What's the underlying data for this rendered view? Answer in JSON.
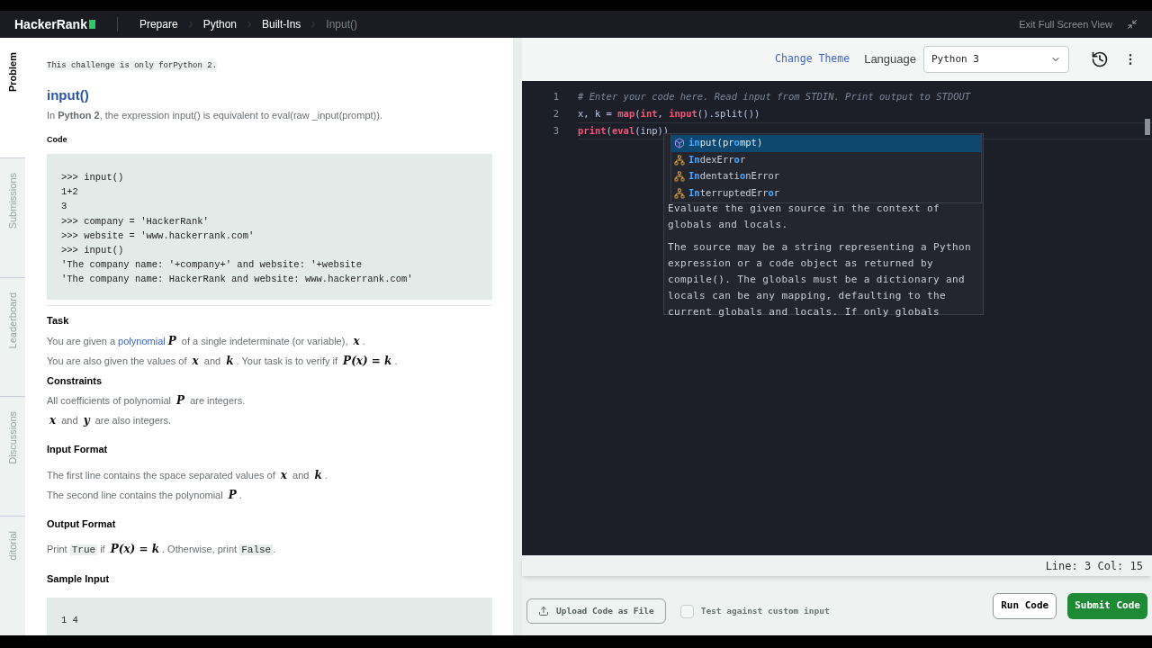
{
  "nav": {
    "logo": "HackerRank",
    "breadcrumbs": [
      {
        "label": "Prepare",
        "current": false
      },
      {
        "label": "Python",
        "current": false
      },
      {
        "label": "Built-Ins",
        "current": false
      },
      {
        "label": "Input()",
        "current": true
      }
    ],
    "exit": "Exit Full Screen View"
  },
  "side_tabs": [
    {
      "label": "Problem",
      "selected": true
    },
    {
      "label": "Submissions",
      "selected": false
    },
    {
      "label": "Leaderboard",
      "selected": false
    },
    {
      "label": "Discussions",
      "selected": false
    },
    {
      "label": "ditorial",
      "selected": false
    }
  ],
  "problem": {
    "notice": "This challenge is only forPython 2.",
    "title": "input()",
    "intro": "In **Python 2**, the expression input() is equivalent to eval(raw _input(prompt)).",
    "code_label": "Code",
    "code": [
      ">>> input()",
      "1+2",
      "3",
      ">>> company = 'HackerRank'",
      ">>> website = 'www.hackerrank.com'",
      ">>> input()",
      "'The company name: '+company+' and website: '+website",
      "'The company name: HackerRank and website: www.hackerrank.com'"
    ],
    "sections": [
      {
        "heading": "Task",
        "paragraphs": [
          [
            {
              "kind": "text",
              "text": "You are given a "
            },
            {
              "kind": "link",
              "text": "polynomial"
            },
            {
              "kind": "math",
              "text": "P"
            },
            {
              "kind": "text",
              "text": " of a single indeterminate (or variable), "
            },
            {
              "kind": "math",
              "text": "x"
            },
            {
              "kind": "text",
              "text": "."
            }
          ],
          [
            {
              "kind": "text",
              "text": "You are also given the values of "
            },
            {
              "kind": "math",
              "text": "x"
            },
            {
              "kind": "text",
              "text": " and "
            },
            {
              "kind": "math",
              "text": "k"
            },
            {
              "kind": "text",
              "text": ". Your task is to verify if "
            },
            {
              "kind": "math",
              "text": "P(x) = k"
            },
            {
              "kind": "text",
              "text": "."
            }
          ]
        ]
      },
      {
        "heading": "Constraints",
        "paragraphs": [
          [
            {
              "kind": "text",
              "text": "All coefficients of polynomial "
            },
            {
              "kind": "math",
              "text": "P"
            },
            {
              "kind": "text",
              "text": " are integers."
            }
          ],
          [
            {
              "kind": "math",
              "text": "x"
            },
            {
              "kind": "text",
              "text": " and "
            },
            {
              "kind": "math",
              "text": "y"
            },
            {
              "kind": "text",
              "text": " are also integers."
            }
          ]
        ]
      },
      {
        "heading": "Input Format",
        "paragraphs": [
          [
            {
              "kind": "text",
              "text": "The first line contains the space separated values of "
            },
            {
              "kind": "math",
              "text": "x"
            },
            {
              "kind": "text",
              "text": " and "
            },
            {
              "kind": "math",
              "text": "k"
            },
            {
              "kind": "text",
              "text": "."
            }
          ],
          [
            {
              "kind": "text",
              "text": "The second line contains the polynomial "
            },
            {
              "kind": "math",
              "text": "P"
            },
            {
              "kind": "text",
              "text": "."
            }
          ]
        ]
      },
      {
        "heading": "Output Format",
        "paragraphs": [
          [
            {
              "kind": "text",
              "text": "Print "
            },
            {
              "kind": "code",
              "text": "True"
            },
            {
              "kind": "text",
              "text": " if "
            },
            {
              "kind": "math",
              "text": "P(x) = k"
            },
            {
              "kind": "text",
              "text": ". Otherwise, print "
            },
            {
              "kind": "code",
              "text": "False"
            },
            {
              "kind": "text",
              "text": "."
            }
          ]
        ]
      }
    ],
    "sample_heading": "Sample Input",
    "sample": [
      "1 4"
    ]
  },
  "editor_header": {
    "change_theme": "Change Theme",
    "language_label": "Language",
    "language": "Python 3"
  },
  "code_lines": [
    {
      "number": "1",
      "current": false,
      "tokens": [
        {
          "kind": "comment",
          "text": "# Enter your code here. Read input from STDIN. Print output to STDOUT"
        }
      ]
    },
    {
      "number": "2",
      "current": false,
      "tokens": [
        {
          "kind": "plain",
          "text": "x, k = "
        },
        {
          "kind": "builtin",
          "text": "map"
        },
        {
          "kind": "plain",
          "text": "("
        },
        {
          "kind": "builtin",
          "text": "int"
        },
        {
          "kind": "plain",
          "text": ", "
        },
        {
          "kind": "builtin",
          "text": "input"
        },
        {
          "kind": "plain",
          "text": "().split())"
        }
      ]
    },
    {
      "number": "3",
      "current": true,
      "tokens": [
        {
          "kind": "builtin",
          "text": "print"
        },
        {
          "kind": "plain",
          "text": "("
        },
        {
          "kind": "builtin",
          "text": "eval"
        },
        {
          "kind": "plain",
          "text": "(inp))"
        }
      ]
    }
  ],
  "suggestions": [
    {
      "kind": "function",
      "selected": true,
      "parts": [
        {
          "text": "in",
          "matched": true
        },
        {
          "text": "put(pr",
          "matched": false
        },
        {
          "text": "o",
          "matched": true
        },
        {
          "text": "mpt)",
          "matched": false
        }
      ]
    },
    {
      "kind": "class",
      "selected": false,
      "parts": [
        {
          "text": "In",
          "matched": true
        },
        {
          "text": "dexErr",
          "matched": false
        },
        {
          "text": "o",
          "matched": true
        },
        {
          "text": "r",
          "matched": false
        }
      ]
    },
    {
      "kind": "class",
      "selected": false,
      "parts": [
        {
          "text": "In",
          "matched": true
        },
        {
          "text": "dentati",
          "matched": false
        },
        {
          "text": "o",
          "matched": true
        },
        {
          "text": "nError",
          "matched": false
        }
      ]
    },
    {
      "kind": "class",
      "selected": false,
      "parts": [
        {
          "text": "In",
          "matched": true
        },
        {
          "text": "terruptedErr",
          "matched": false
        },
        {
          "text": "o",
          "matched": true
        },
        {
          "text": "r",
          "matched": false
        }
      ]
    }
  ],
  "doc": [
    "Evaluate the given source in the context of globals and locals.",
    "The source may be a string representing a Python expression or a code object as returned by compile(). The globals must be a dictionary and locals can be any mapping, defaulting to the current globals and locals. If only globals"
  ],
  "status": "Line: 3 Col: 15",
  "footer": {
    "upload": "Upload Code as File",
    "custom_input": {
      "label": "Test against custom input",
      "checked": false
    },
    "run": "Run Code",
    "submit": "Submit Code"
  }
}
